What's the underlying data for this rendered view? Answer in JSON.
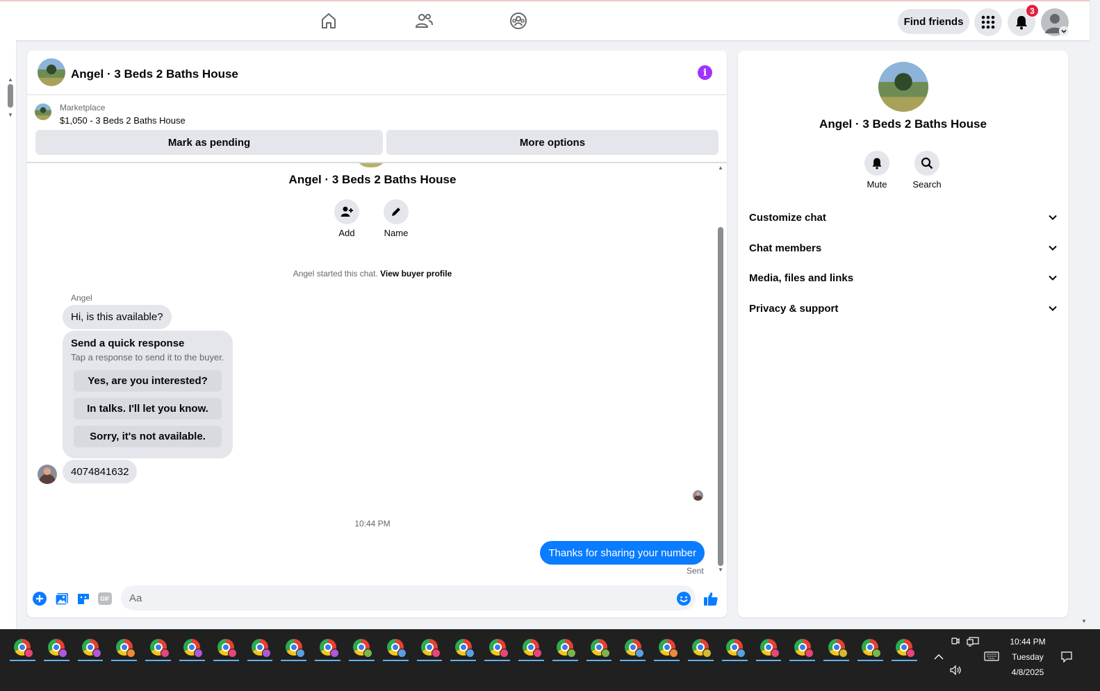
{
  "topbar": {
    "find_friends_label": "Find friends",
    "notification_count": "3"
  },
  "chat": {
    "title": "Angel · 3 Beds 2 Baths House",
    "marketplace": {
      "label": "Marketplace",
      "item": "$1,050 - 3 Beds 2 Baths House",
      "mark_pending_label": "Mark as pending",
      "more_options_label": "More options"
    },
    "thread_name": "Angel · 3 Beds 2 Baths House",
    "actions": [
      {
        "label": "Add",
        "icon": "add-person-icon"
      },
      {
        "label": "Name",
        "icon": "pencil-icon"
      }
    ],
    "started_text": "Angel started this chat.",
    "started_link": "View buyer profile",
    "sender_name": "Angel",
    "first_message": "Hi, is this available?",
    "quick_response": {
      "title": "Send a quick response",
      "subtitle": "Tap a response to send it to the buyer.",
      "options": [
        "Yes, are you interested?",
        "In talks. I'll let you know.",
        "Sorry, it's not available."
      ]
    },
    "phone_message": "4074841632",
    "time_separator": "10:44 PM",
    "my_message": "Thanks for sharing your number",
    "status": "Sent",
    "composer_placeholder": "Aa"
  },
  "info_panel": {
    "name": "Angel · 3 Beds 2 Baths House",
    "actions": [
      {
        "label": "Mute",
        "icon": "bell-icon"
      },
      {
        "label": "Search",
        "icon": "search-icon"
      }
    ],
    "sections": [
      "Customize chat",
      "Chat members",
      "Media, files and links",
      "Privacy & support"
    ]
  },
  "taskbar": {
    "time": "10:44 PM",
    "day": "Tuesday",
    "date": "4/8/2025",
    "app_profile_colors": [
      "#e8457a",
      "#b058d8",
      "#b058d8",
      "#f08a3a",
      "#e8457a",
      "#b058d8",
      "#e8457a",
      "#b058d8",
      "#5a9fe0",
      "#b058d8",
      "#7ab648",
      "#5a9fe0",
      "#e8457a",
      "#5a9fe0",
      "#e8457a",
      "#e8457a",
      "#7ab648",
      "#7ab648",
      "#5a9fe0",
      "#f08a3a",
      "#d8b830",
      "#5a9fe0",
      "#e8457a",
      "#e8457a",
      "#d8b830",
      "#7ab648",
      "#e8457a"
    ]
  },
  "colors": {
    "messenger_blue": "#0a7cff",
    "info_purple": "#a033ff",
    "badge_red": "#e41e3f"
  }
}
